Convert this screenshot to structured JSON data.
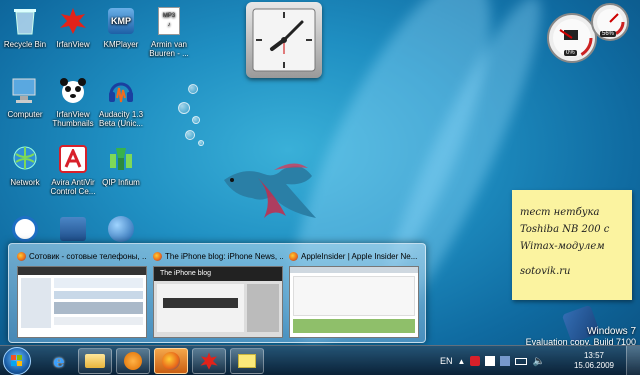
{
  "desktop_icons": [
    {
      "label": "Recycle Bin",
      "icon": "recycle-bin-icon"
    },
    {
      "label": "IrfanView",
      "icon": "irfanview-icon"
    },
    {
      "label": "KMPlayer",
      "icon": "kmplayer-icon"
    },
    {
      "label": "Armin van Buuren - ...",
      "icon": "mp3-file-icon"
    },
    {
      "label": "Computer",
      "icon": "computer-icon"
    },
    {
      "label": "IrfanView Thumbnails",
      "icon": "irfanview-thumbnails-icon"
    },
    {
      "label": "Audacity 1.3 Beta (Unic...",
      "icon": "audacity-icon"
    },
    {
      "label": "Network",
      "icon": "network-icon"
    },
    {
      "label": "Avira AntiVir Control Ce...",
      "icon": "avira-icon"
    },
    {
      "label": "QIP Infium",
      "icon": "qip-icon"
    }
  ],
  "gadgets": {
    "meter_cpu": "0%",
    "meter_ram": "56%"
  },
  "note": {
    "lines": [
      "тест нетбука",
      "Toshiba NB 200 с",
      "Wimax-модулем"
    ],
    "footer": "sotovik.ru"
  },
  "thumbnails": [
    {
      "title": "Сотовик - сотовые телефоны, ..."
    },
    {
      "title": "The iPhone blog: iPhone News, ..."
    },
    {
      "title": "AppleInsider | Apple Insider Ne..."
    }
  ],
  "thumbnail_previews": {
    "iphone_blog_banner": "The iPhone blog"
  },
  "watermark": {
    "product": "Windows 7",
    "build": "Evaluation copy. Build 7100"
  },
  "taskbar": {
    "language": "EN",
    "time": "13:57",
    "date": "15.06.2009",
    "buttons": [
      {
        "name": "internet-explorer",
        "icon": "internet-explorer-icon"
      },
      {
        "name": "windows-explorer",
        "icon": "folder-icon"
      },
      {
        "name": "media-player",
        "icon": "media-player-icon"
      },
      {
        "name": "firefox",
        "icon": "firefox-icon"
      },
      {
        "name": "irfanview",
        "icon": "irfanview-icon"
      },
      {
        "name": "sticky-notes",
        "icon": "sticky-notes-icon"
      }
    ]
  }
}
